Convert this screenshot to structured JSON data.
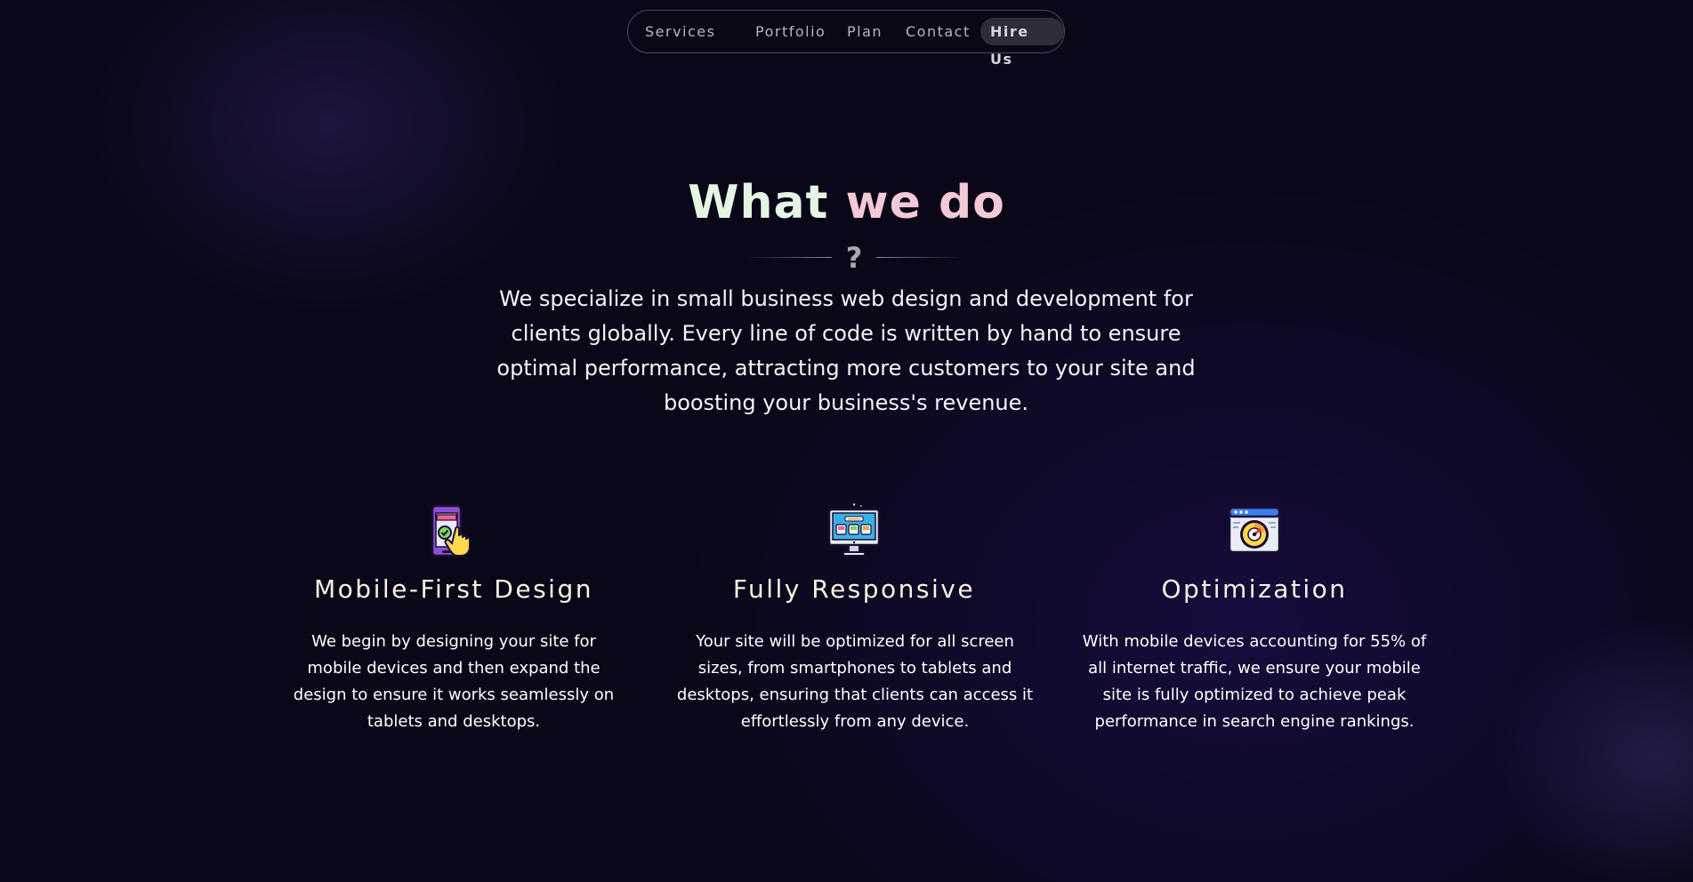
{
  "nav": {
    "items": [
      {
        "label": "Services"
      },
      {
        "label": "Portfolio"
      },
      {
        "label": "Plan"
      },
      {
        "label": "Contact"
      },
      {
        "label": "Hire Us"
      }
    ]
  },
  "hero": {
    "heading_part1": "What ",
    "heading_part2": "we do",
    "divider_symbol": "?",
    "intro": "We specialize in small business web design and development for clients globally. Every line of code is written by hand to ensure optimal performance, attracting more customers to your site and boosting your business's revenue."
  },
  "features": [
    {
      "icon": "mobile-touch-icon",
      "title": "Mobile-First Design",
      "description": "We begin by designing your site for mobile devices and then expand the design to ensure it works seamlessly on tablets and desktops."
    },
    {
      "icon": "desktop-monitor-icon",
      "title": "Fully Responsive",
      "description": "Your site will be optimized for all screen sizes, from smartphones to tablets and desktops, ensuring that clients can access it effortlessly from any device."
    },
    {
      "icon": "speed-gauge-browser-icon",
      "title": "Optimization",
      "description": "With mobile devices accounting for 55% of all internet traffic, we ensure your mobile site is fully optimized to achieve peak performance in search engine rankings."
    }
  ],
  "colors": {
    "background": "#0a0818",
    "heading_first": "#e4f5e4",
    "heading_second": "#f3c9d6",
    "feature_title": "#fbf0e0",
    "nav_text": "#b8b4c8",
    "nav_active_bg": "#2e2c38"
  }
}
